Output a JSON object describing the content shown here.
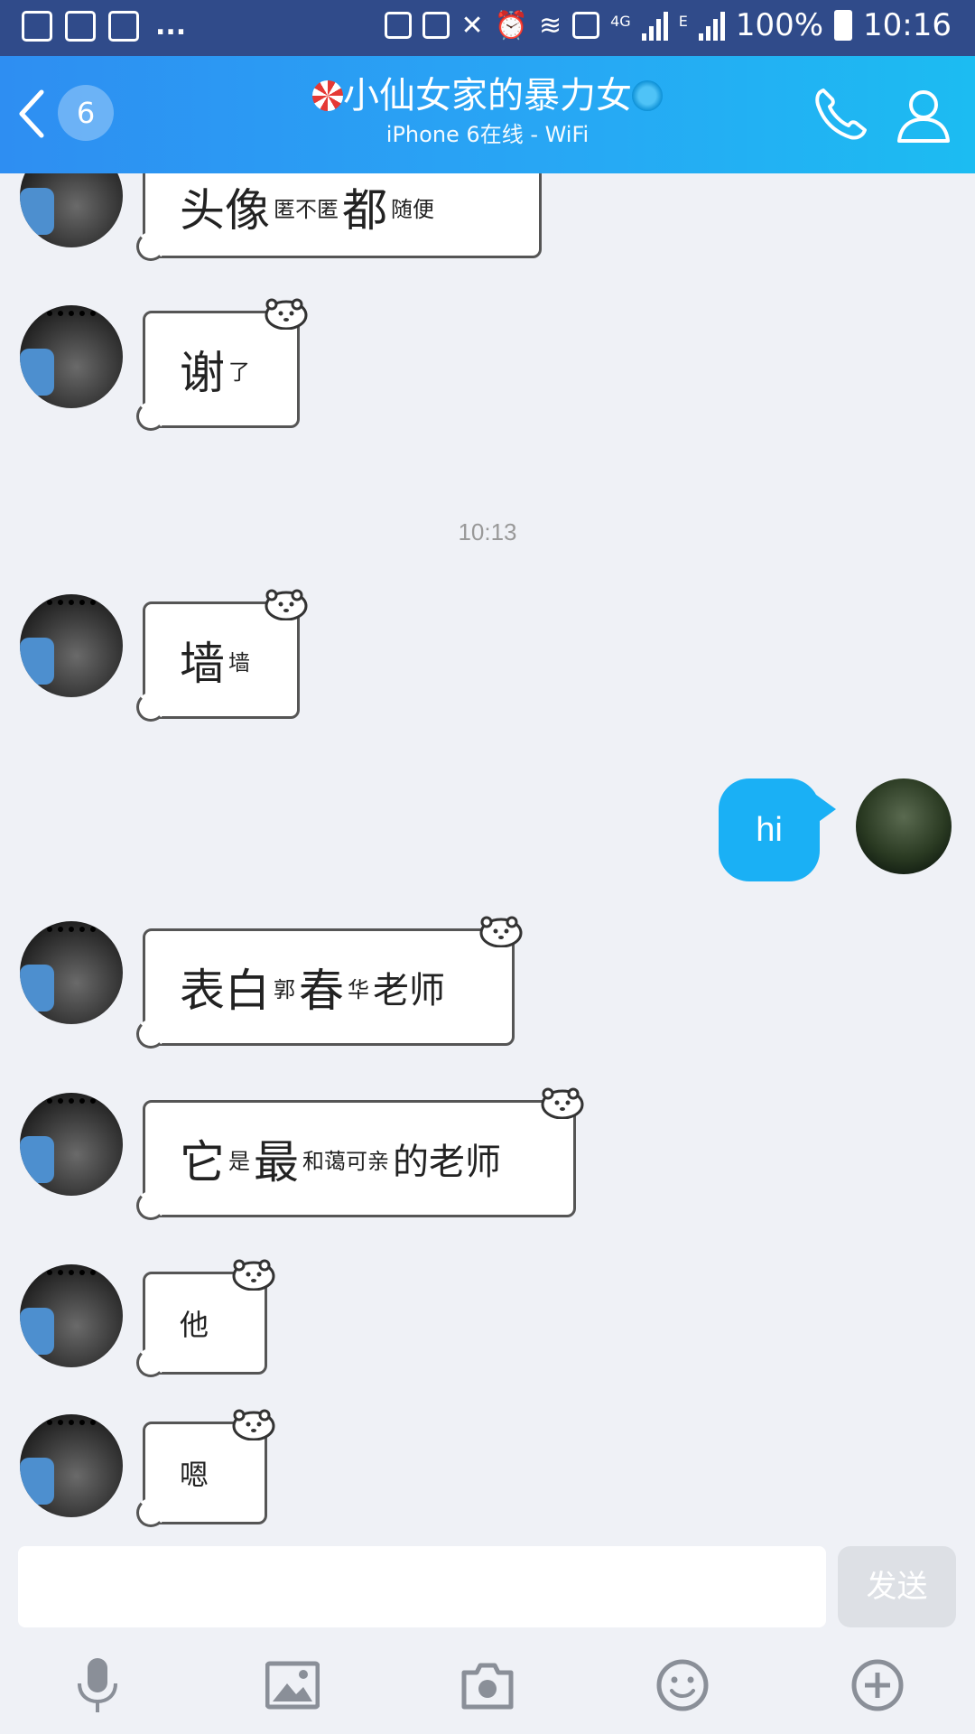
{
  "status_bar": {
    "net": "4G",
    "net2": "E",
    "battery": "100%",
    "time": "10:16",
    "dots": "..."
  },
  "header": {
    "unread_count": "6",
    "title": "小仙女家的暴力女",
    "subtitle": "iPhone 6在线 - WiFi",
    "bg_colors": [
      "#2e8ef2",
      "#1cbcf2"
    ]
  },
  "messages": {
    "m1": {
      "a": "头像",
      "b": "匿不匿",
      "c": "都",
      "d": "随便"
    },
    "m2": {
      "a": "谢",
      "b": "了"
    },
    "timestamp": "10:13",
    "m3": {
      "a": "墙",
      "b": "墙"
    },
    "me": {
      "text": "hi"
    },
    "m4": {
      "a": "表白",
      "b": "郭",
      "c": "春",
      "d": "华",
      "e": "老师"
    },
    "m5": {
      "a": "它",
      "b": "是",
      "c": "最",
      "d": "和蔼可亲",
      "e": "的老师"
    },
    "m6": {
      "a": "他"
    },
    "m7": {
      "a": "嗯"
    }
  },
  "composer": {
    "input_value": "",
    "send_label": "发送"
  },
  "toolbar_icons": [
    "microphone-icon",
    "image-icon",
    "camera-icon",
    "emoji-icon",
    "plus-circle-icon"
  ],
  "colors": {
    "accent": "#1ab0f5",
    "background": "#eff1f6"
  }
}
